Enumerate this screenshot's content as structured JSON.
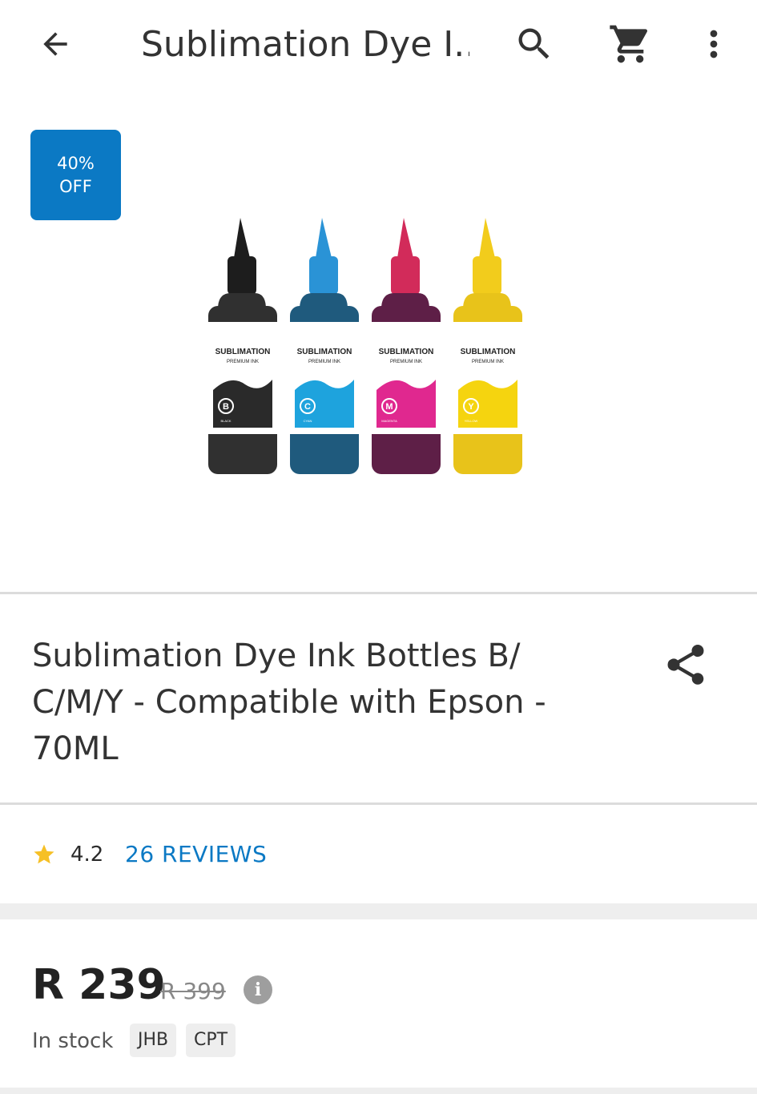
{
  "appbar": {
    "title": "Sublimation Dye I...",
    "icons": [
      "back-arrow-icon",
      "search-icon",
      "cart-icon",
      "more-vert-icon"
    ]
  },
  "hero": {
    "badge_line1": "40%",
    "badge_line2": "OFF",
    "bottles": [
      {
        "brand": "SUBLIMATION",
        "subtitle": "PREMIUM INK",
        "letter": "B",
        "name": "BLACK",
        "cap": "#1d1d1d",
        "body": "#303030",
        "wave": "#2a2a2a"
      },
      {
        "brand": "SUBLIMATION",
        "subtitle": "PREMIUM INK",
        "letter": "C",
        "name": "CYAN",
        "cap": "#2a93d6",
        "body": "#1f5a7d",
        "wave": "#1ea3dd"
      },
      {
        "brand": "SUBLIMATION",
        "subtitle": "PREMIUM INK",
        "letter": "M",
        "name": "MAGENTA",
        "cap": "#d22b5a",
        "body": "#5e1f47",
        "wave": "#e0288f"
      },
      {
        "brand": "SUBLIMATION",
        "subtitle": "PREMIUM INK",
        "letter": "Y",
        "name": "YELLOW",
        "cap": "#f2cc1c",
        "body": "#e8c31a",
        "wave": "#f5d40f"
      }
    ]
  },
  "product": {
    "title": "Sublimation Dye Ink Bottles B/ C/M/Y - Compatible with Epson - 70ML"
  },
  "rating": {
    "value": "4.2",
    "reviews_label": "26 REVIEWS"
  },
  "pricing": {
    "price": "R 239",
    "old_price": "R 399",
    "info_symbol": "i",
    "stock_label": "In stock",
    "locations": [
      "JHB",
      "CPT"
    ]
  },
  "colors": {
    "accent": "#0b79c4",
    "star": "#f6c026"
  }
}
